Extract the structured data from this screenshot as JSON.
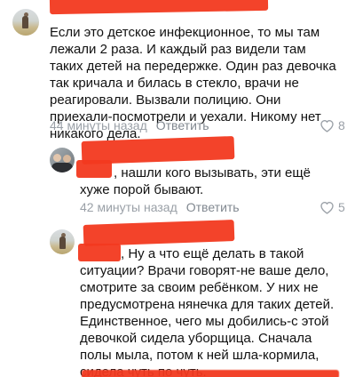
{
  "comments": [
    {
      "text": "Если это детское инфекционное, то мы там лежали 2 раза. И каждый раз видели там таких детей на передержке. Один раз девочка так кричала и билась в стекло, врачи не реагировали. Вызвали полицию. Они приехали-посмотрели и уехали. Никому нет никакого дела.",
      "time": "44 минуты назад",
      "reply_label": "Ответить",
      "likes": "8"
    },
    {
      "text": ", нашли кого вызывать, эти ещё хуже порой бывают.",
      "time": "42 минуты назад",
      "reply_label": "Ответить",
      "likes": "5"
    },
    {
      "text": ", Ну а что ещё делать в такой ситуации? Врачи говорят-не ваше дело, смотрите за своим ребёнком. У них не предусмотрена нянечка для таких детей. Единственное, чего мы добились-с этой девочкой сидела уборщица. Сначала полы мыла, потом к ней шла-кормила, сидела чуть по чуть."
    }
  ],
  "colors": {
    "redaction": "#f2391f",
    "meta": "#9aa0a7"
  }
}
